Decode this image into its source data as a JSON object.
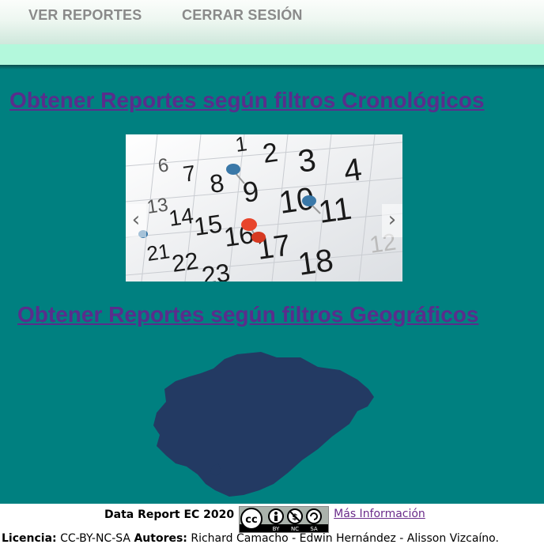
{
  "nav": {
    "items": [
      {
        "label": "VER REPORTES"
      },
      {
        "label": "CERRAR SESIÓN"
      }
    ]
  },
  "sections": {
    "chrono_link": "Obtener Reportes según filtros Cronológicos",
    "geo_link": "Obtener Reportes según filtros Geográficos"
  },
  "carousel": {
    "prev": "‹",
    "next": "›",
    "calendar_numbers": [
      "1",
      "2",
      "3",
      "4",
      "6",
      "7",
      "8",
      "9",
      "10",
      "11",
      "13",
      "14",
      "15",
      "16",
      "17",
      "18",
      "21",
      "22",
      "23",
      "12"
    ]
  },
  "footer": {
    "title": "Data Report EC 2020",
    "cc_badge": {
      "symbols": [
        "cc",
        "by",
        "nc",
        "sa"
      ],
      "labels": [
        "BY",
        "NC",
        "SA"
      ]
    },
    "more_info": "Más Información",
    "license_label": "Licencia:",
    "license_value": "CC-BY-NC-SA",
    "authors_label": "Autores:",
    "authors_value": "Richard Camacho - Edwin Hernández - Alisson Vizcaíno."
  },
  "colors": {
    "page_bg": "#008080",
    "link": "#5a2d8c",
    "nav_text": "#8a8a8a",
    "mint": "#b3f8dc",
    "map_fill": "#233a63",
    "pin_blue": "#3a78a8",
    "pin_red": "#e8452c"
  }
}
